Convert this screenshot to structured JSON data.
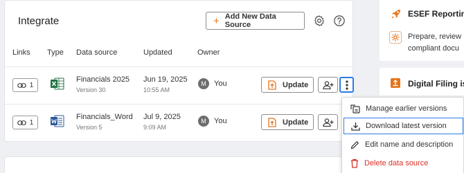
{
  "header": {
    "title": "Integrate",
    "add_button": "Add New Data Source"
  },
  "table": {
    "columns": [
      "Links",
      "Type",
      "Data source",
      "Updated",
      "Owner"
    ],
    "rows": [
      {
        "links": "1",
        "type_icon": "excel-icon",
        "name": "Financials 2025",
        "version": "Version 30",
        "date": "Jun 19, 2025",
        "time": "10:55 AM",
        "owner_initial": "M",
        "owner": "You",
        "update_label": "Update"
      },
      {
        "links": "1",
        "type_icon": "word-icon",
        "name": "Financials_Word",
        "version": "Version 5",
        "date": "Jul 9, 2025",
        "time": "9:09 AM",
        "owner_initial": "M",
        "owner": "You",
        "update_label": "Update"
      }
    ]
  },
  "menu": {
    "items": [
      {
        "label": "Manage earlier versions",
        "icon": "versions-icon"
      },
      {
        "label": "Download latest version",
        "icon": "download-icon"
      },
      {
        "label": "Edit name and description",
        "icon": "pencil-icon"
      },
      {
        "label": "Delete data source",
        "icon": "trash-icon"
      }
    ]
  },
  "right_panel": {
    "esef_title": "ESEF Reporting",
    "esef_line1": "Prepare, review",
    "esef_line2": "compliant docu",
    "filing_title": "Digital Filing is"
  },
  "colors": {
    "accent_orange": "#e8731b",
    "focus_blue": "#2d7be5",
    "danger_red": "#d93025",
    "excel_green": "#1f7244",
    "word_blue": "#2b579a"
  }
}
